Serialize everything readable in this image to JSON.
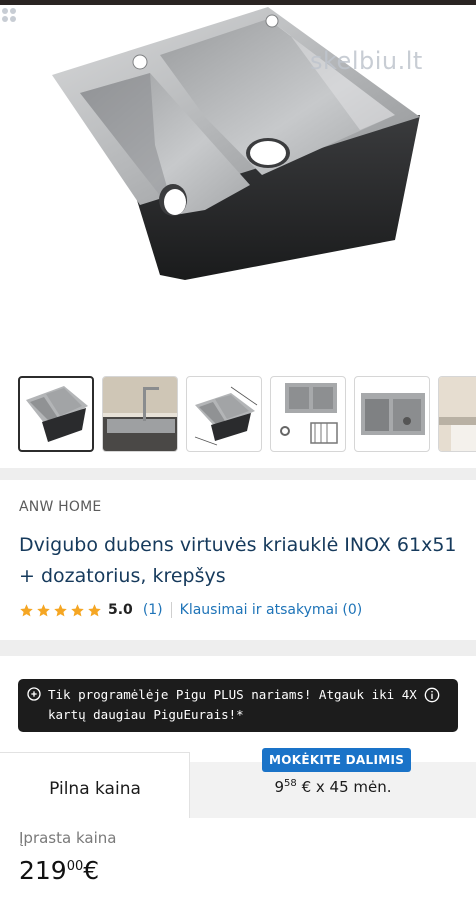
{
  "watermark": "skelbiu.lt",
  "thumbnails": [
    {
      "name": "thumb-sink-top-view",
      "active": true
    },
    {
      "name": "thumb-sink-installed"
    },
    {
      "name": "thumb-sink-dimensions"
    },
    {
      "name": "thumb-sink-accessories"
    },
    {
      "name": "thumb-sink-front"
    },
    {
      "name": "thumb-partial"
    }
  ],
  "product": {
    "brand": "ANW HOME",
    "title": "Dvigubo dubens virtuvės kriauklė INOX 61x51 + dozatorius, krepšys",
    "rating": "5.0",
    "reviews": "(1)",
    "qa_link": "Klausimai ir atsakymai (0)"
  },
  "banner": {
    "text": "Tik programėlėje Pigu PLUS nariams! Atgauk iki 4X kartų daugiau PiguEurais!*"
  },
  "pricing": {
    "tab_full": "Pilna kaina",
    "badge": "MOKĖKITE DALIMIS",
    "install_whole": "9",
    "install_cents": "58",
    "install_suffix": "€ x 45 mėn.",
    "usual_label": "Įprasta kaina",
    "price_whole": "219",
    "price_cents": "00",
    "currency": "€"
  },
  "colors": {
    "link": "#1f74b8",
    "title": "#163a5c",
    "star": "#f5a623",
    "badge": "#1a73c8",
    "banner": "#1c1c1c"
  }
}
